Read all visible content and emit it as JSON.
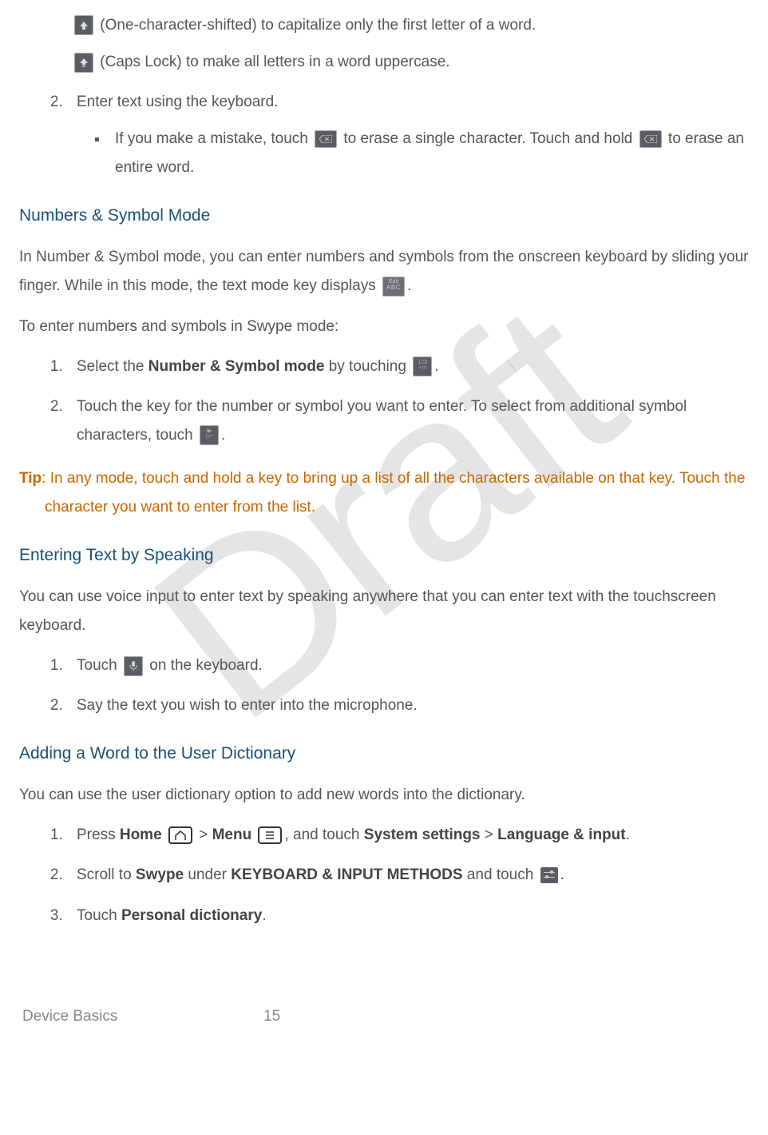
{
  "watermark": "Draft",
  "shift_line1": "(One-character-shifted) to capitalize only the first letter of a word.",
  "shift_line2": "(Caps Lock) to make all letters in a word uppercase.",
  "step2_intro": "Enter text using the keyboard.",
  "step2_bullet_a": "If you make a mistake, touch ",
  "step2_bullet_b": " to erase a single character. Touch and hold ",
  "step2_bullet_c": " to erase an entire word.",
  "h_numbers": "Numbers & Symbol Mode",
  "numbers_para_a": "In Number & Symbol mode, you can enter numbers and symbols from the onscreen keyboard by sliding your finger. While in this mode, the text mode key displays ",
  "numbers_para_b": ".",
  "numbers_para2": "To enter numbers and symbols in Swype mode:",
  "num_step1_a": "Select the ",
  "num_step1_bold": "Number & Symbol mode",
  "num_step1_b": " by touching ",
  "num_step1_c": ".",
  "num_step2_a": "Touch the key for the number or symbol you want to enter. To select from additional symbol characters, touch ",
  "num_step2_b": ".",
  "tip_label": "Tip",
  "tip_body": ": In any mode, touch and hold a key to bring up a list of all the characters available on that key. Touch the character you want to enter from the list.",
  "h_voice": "Entering Text by Speaking",
  "voice_para": "You can use voice input to enter text by speaking anywhere that you can enter text with the touchscreen keyboard.",
  "voice_step1_a": "Touch ",
  "voice_step1_b": " on the keyboard.",
  "voice_step2": "Say the text you wish to enter into the microphone.",
  "h_dict": "Adding a Word to the User Dictionary",
  "dict_para": "You can use the user dictionary option to add new words into the dictionary.",
  "dict_step1_a": "Press ",
  "dict_step1_home": "Home",
  "dict_step1_b": " > ",
  "dict_step1_menu": "Menu",
  "dict_step1_c": ", and touch ",
  "dict_step1_sys": "System settings",
  "dict_step1_d": " > ",
  "dict_step1_lang": "Language & input",
  "dict_step1_e": ".",
  "dict_step2_a": "Scroll to ",
  "dict_step2_swype": "Swype",
  "dict_step2_b": " under ",
  "dict_step2_kb": "KEYBOARD & INPUT METHODS",
  "dict_step2_c": " and touch ",
  "dict_step2_d": ".",
  "dict_step3_a": "Touch ",
  "dict_step3_pd": "Personal dictionary",
  "dict_step3_b": ".",
  "footer_section": "Device Basics",
  "footer_page": "15",
  "abc_top": "Edit",
  "abc_bot": "ABC"
}
